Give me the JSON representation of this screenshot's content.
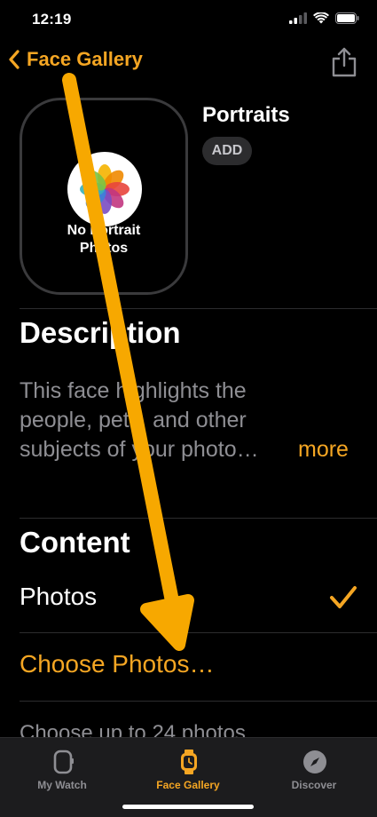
{
  "status_bar": {
    "time": "12:19"
  },
  "nav": {
    "back_label": "Face Gallery"
  },
  "face": {
    "name": "Portraits",
    "add_label": "ADD",
    "placeholder_text": "No Portrait\nPhotos"
  },
  "description": {
    "heading": "Description",
    "text": "This face highlights the people, pets, and other subjects of your photo…",
    "more_label": "more"
  },
  "content": {
    "heading": "Content",
    "photos_label": "Photos",
    "photos_selected": true,
    "choose_photos_label": "Choose Photos…",
    "footnote_partial": "Choose up to 24 photos"
  },
  "tabs": [
    {
      "label": "My Watch",
      "icon": "watch-icon",
      "active": false
    },
    {
      "label": "Face Gallery",
      "icon": "face-gallery-icon",
      "active": true
    },
    {
      "label": "Discover",
      "icon": "compass-icon",
      "active": false
    }
  ],
  "colors": {
    "accent": "#f5a623",
    "background": "#000000",
    "secondary_text": "#8e8e93",
    "annotation_arrow": "#f7a800"
  }
}
